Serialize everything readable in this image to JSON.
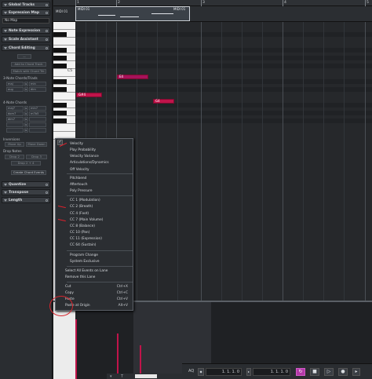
{
  "inspector": {
    "sections": [
      {
        "label": "Global Tracks",
        "top": 0
      },
      {
        "label": "Expression Map",
        "top": 0
      }
    ],
    "global_tracks": "Global Tracks",
    "expression_map": "Expression Map",
    "expression_map_value": "No Map",
    "note_expression": "Note Expression",
    "scale_assistant": "Scale Assistant",
    "chord_editing": "Chord Editing",
    "add_to_chord_track": "Add to Chord Track",
    "match_with_chord_trk": "Match with Chord Trk",
    "three_note_label": "3-Note Chords/Triads",
    "four_note_label": "4-Note Chords",
    "triads": [
      "maj",
      "min",
      "aug",
      "dim"
    ],
    "four_note": [
      "maj7",
      "min7",
      "dom7",
      "m7b5",
      "dim7"
    ],
    "inversions_label": "Inversions",
    "move_up": "Move Up",
    "move_down": "Move Down",
    "drop_notes_label": "Drop Notes",
    "drop2": "Drop 2",
    "drop3": "Drop 3",
    "drop24": "Drop 2 + 4",
    "create_chord_events": "Create Chord Events",
    "quantize": "Quantize",
    "transpose": "Transpose",
    "length": "Length"
  },
  "editor": {
    "ruler_bars": [
      "1",
      "2",
      "3",
      "4",
      "5"
    ],
    "track_name": "MIDI 01",
    "part_label_left": "MIDI 01",
    "part_label_right": "MIDI 01",
    "key_label": "C5",
    "notes": [
      {
        "label": "E4"
      },
      {
        "label": "G#4"
      },
      {
        "label": "G4"
      }
    ]
  },
  "menu": {
    "items": [
      {
        "label": "Velocity",
        "checked": true
      },
      {
        "label": "Play Probability"
      },
      {
        "label": "Velocity Variance"
      },
      {
        "label": "Articulations/Dynamics"
      },
      {
        "label": "Off Velocity"
      },
      {
        "label": "Pitchbend"
      },
      {
        "label": "Aftertouch"
      },
      {
        "label": "Poly Pressure"
      },
      {
        "label": "CC 1 (Modulation)"
      },
      {
        "label": "CC 2 (Breath)"
      },
      {
        "label": "CC 4 (Foot)"
      },
      {
        "label": "CC 7 (Main Volume)"
      },
      {
        "label": "CC 8 (Balance)"
      },
      {
        "label": "CC 10 (Pan)"
      },
      {
        "label": "CC 11 (Expression)"
      },
      {
        "label": "CC 64 (Sustain)"
      },
      {
        "label": "Program Change"
      },
      {
        "label": "System Exclusive"
      },
      {
        "label": "Select All Events on Lane"
      },
      {
        "label": "Remove this Lane"
      },
      {
        "label": "Cut",
        "shortcut": "Ctrl+X"
      },
      {
        "label": "Copy",
        "shortcut": "Ctrl+C"
      },
      {
        "label": "Paste",
        "shortcut": "Ctrl+V"
      },
      {
        "label": "Paste at Origin",
        "shortcut": "Alt+V"
      }
    ]
  },
  "transport": {
    "aq": "AQ",
    "pos_left": "1. 1. 1. 0",
    "pos_right": "1. 1. 1. 0",
    "cycle_icon": "cycle-icon",
    "stop_icon": "stop-icon",
    "play_icon": "play-icon",
    "record_icon": "record-icon"
  },
  "colors": {
    "note": "#c0144a",
    "accent_cycle": "#b23aa8",
    "annotation_red": "#e0202c"
  }
}
